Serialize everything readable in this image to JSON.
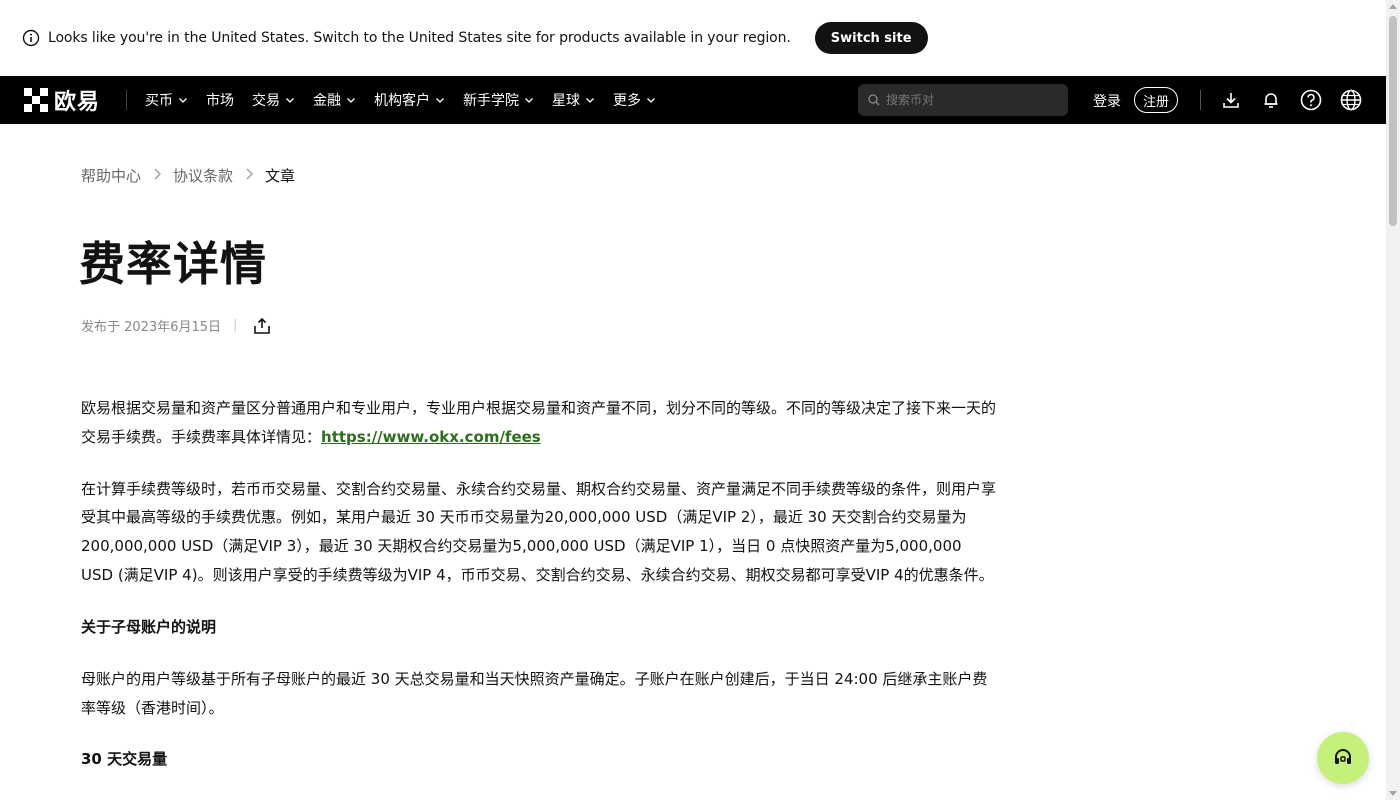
{
  "banner": {
    "message": "Looks like you're in the United States. Switch to the United States site for products available in your region.",
    "switch_label": "Switch site",
    "info_icon": "info-icon"
  },
  "nav": {
    "logo_text": "欧易",
    "items": [
      {
        "label": "买币",
        "has_dropdown": true
      },
      {
        "label": "市场",
        "has_dropdown": false
      },
      {
        "label": "交易",
        "has_dropdown": true
      },
      {
        "label": "金融",
        "has_dropdown": true
      },
      {
        "label": "机构客户",
        "has_dropdown": true
      },
      {
        "label": "新手学院",
        "has_dropdown": true
      },
      {
        "label": "星球",
        "has_dropdown": true
      },
      {
        "label": "更多",
        "has_dropdown": true
      }
    ],
    "search_placeholder": "搜索币对",
    "login_label": "登录",
    "signup_label": "注册",
    "icons": [
      "download-icon",
      "bell-icon",
      "help-icon",
      "globe-icon"
    ]
  },
  "breadcrumb": {
    "items": [
      "帮助中心",
      "协议条款"
    ],
    "current": "文章"
  },
  "article": {
    "title": "费率详情",
    "published": "发布于 2023年6月15日",
    "p1_text": "欧易根据交易量和资产量区分普通用户和专业用户，专业用户根据交易量和资产量不同，划分不同的等级。不同的等级决定了接下来一天的交易手续费。手续费率具体详情见：",
    "p1_link": "https://www.okx.com/fees",
    "p2": "在计算手续费等级时，若币币交易量、交割合约交易量、永续合约交易量、期权合约交易量、资产量满足不同手续费等级的条件，则用户享受其中最高等级的手续费优惠。例如，某用户最近 30 天币币交易量为20,000,000 USD（满足VIP 2），最近 30 天交割合约交易量为200,000,000 USD（满足VIP 3），最近 30 天期权合约交易量为5,000,000 USD（满足VIP 1），当日 0 点快照资产量为5,000,000 USD (满足VIP 4)。则该用户享受的手续费等级为VIP 4，币币交易、交割合约交易、永续合约交易、期权交易都可享受VIP 4的优惠条件。",
    "h1": "关于子母账户的说明",
    "p3": "母账户的用户等级基于所有子母账户的最近 30 天总交易量和当天快照资产量确定。子账户在账户创建后，于当日 24:00 后继承主账户费率等级（香港时间）。",
    "h2": "30 天交易量"
  },
  "colors": {
    "nav_bg": "#000000",
    "accent_link": "#2c6e1e",
    "support_bg": "#c5f07c"
  },
  "support_icon": "headset-icon"
}
